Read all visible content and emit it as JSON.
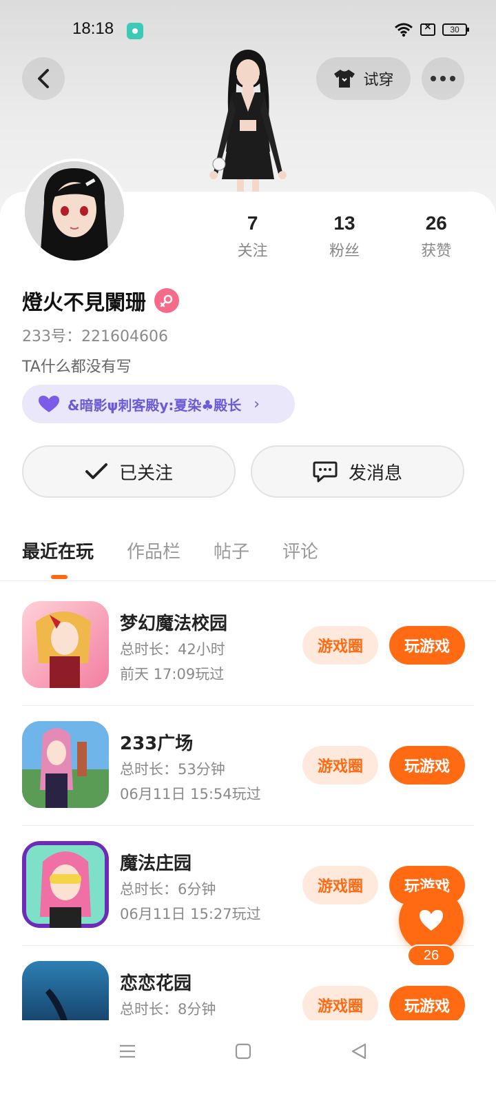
{
  "status_bar": {
    "time": "18:18",
    "battery": "30"
  },
  "header": {
    "try_on_label": "试穿"
  },
  "stats": [
    {
      "value": "7",
      "label": "关注"
    },
    {
      "value": "13",
      "label": "粉丝"
    },
    {
      "value": "26",
      "label": "获赞"
    }
  ],
  "profile": {
    "name": "燈火不見闌珊",
    "uid": "233号：221604606",
    "bio": "TA什么都没有写",
    "family_tag": "&暗影ψ刺客殿y:夏染♣殿长"
  },
  "actions": {
    "follow_label": "已关注",
    "message_label": "发消息"
  },
  "tabs": [
    "最近在玩",
    "作品栏",
    "帖子",
    "评论"
  ],
  "games": [
    {
      "title": "梦幻魔法校园",
      "duration": "总时长：42小时",
      "last_played": "前天 17:09玩过",
      "circle_label": "游戏圈",
      "play_label": "玩游戏"
    },
    {
      "title": "233广场",
      "duration": "总时长：53分钟",
      "last_played": "06月11日 15:54玩过",
      "circle_label": "游戏圈",
      "play_label": "玩游戏"
    },
    {
      "title": "魔法庄园",
      "duration": "总时长：6分钟",
      "last_played": "06月11日 15:27玩过",
      "circle_label": "游戏圈",
      "play_label": "玩游戏"
    },
    {
      "title": "恋恋花园",
      "duration": "总时长：8分钟",
      "last_played": "",
      "circle_label": "游戏圈",
      "play_label": "玩游戏"
    }
  ],
  "like": {
    "count": "26"
  },
  "colors": {
    "accent": "#ff6a13",
    "family_tag_bg": "#ebe7fb",
    "family_tag_text": "#6a5bd6",
    "gender_badge": "#f66a8a"
  }
}
